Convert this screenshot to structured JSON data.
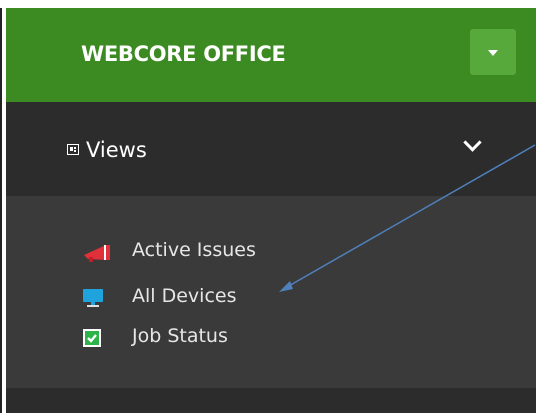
{
  "header": {
    "title": "WEBCORE OFFICE",
    "toggle_icon": "caret-down-icon",
    "bg_color": "#3c8a22"
  },
  "nav": {
    "section": {
      "label": "Views",
      "icon": "views-icon",
      "expand_icon": "chevron-down-icon"
    },
    "items": [
      {
        "label": "Active Issues",
        "icon": "megaphone-icon"
      },
      {
        "label": "All Devices",
        "icon": "monitor-icon"
      },
      {
        "label": "Job Status",
        "icon": "checkbox-icon"
      }
    ]
  },
  "annotation": {
    "type": "arrow",
    "color": "#4f81bd"
  }
}
